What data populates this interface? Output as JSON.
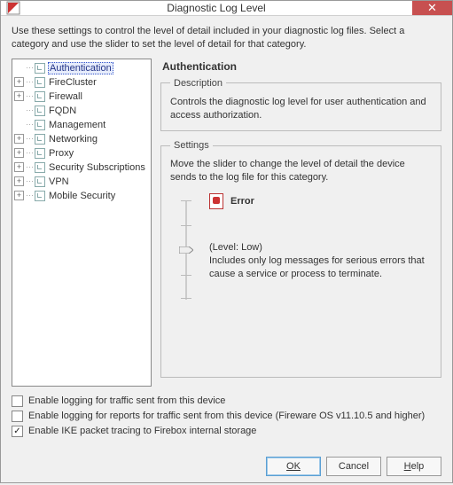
{
  "window": {
    "title": "Diagnostic Log Level"
  },
  "intro": "Use these settings to control the level of detail included in your diagnostic log files. Select a category and use the slider to set the level of detail for that category.",
  "tree": {
    "items": [
      {
        "label": "Authentication",
        "expandable": false,
        "selected": true
      },
      {
        "label": "FireCluster",
        "expandable": true
      },
      {
        "label": "Firewall",
        "expandable": true
      },
      {
        "label": "FQDN",
        "expandable": false
      },
      {
        "label": "Management",
        "expandable": false
      },
      {
        "label": "Networking",
        "expandable": true
      },
      {
        "label": "Proxy",
        "expandable": true
      },
      {
        "label": "Security Subscriptions",
        "expandable": true
      },
      {
        "label": "VPN",
        "expandable": true
      },
      {
        "label": "Mobile Security",
        "expandable": true
      }
    ]
  },
  "detail": {
    "heading": "Authentication",
    "description_legend": "Description",
    "description_text": "Controls the diagnostic log level for user authentication and access authorization.",
    "settings_legend": "Settings",
    "settings_text": "Move the slider to change the level of detail the device sends to the log file for this category.",
    "level_name": "Error",
    "level_tag": "(Level: Low)",
    "level_desc": "Includes only log messages for serious errors that cause a service or process to terminate."
  },
  "checkboxes": {
    "traffic": {
      "label": "Enable logging for traffic sent from this device",
      "checked": false
    },
    "reports": {
      "label": "Enable logging for reports for traffic sent from this device (Fireware OS v11.10.5 and higher)",
      "checked": false
    },
    "ike": {
      "label": "Enable IKE packet tracing to Firebox internal storage",
      "checked": true
    }
  },
  "buttons": {
    "ok": "OK",
    "cancel": "Cancel",
    "help": "Help"
  }
}
